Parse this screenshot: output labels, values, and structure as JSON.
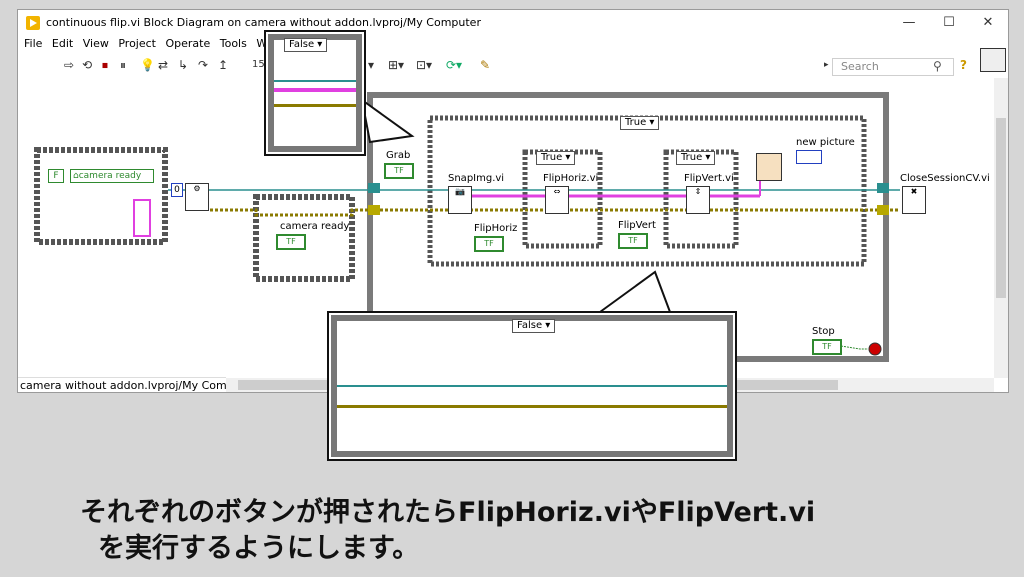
{
  "window": {
    "title": "continuous flip.vi Block Diagram on camera without addon.lvproj/My Computer",
    "minimize": "—",
    "maximize": "☐",
    "close": "✕"
  },
  "menu": [
    "File",
    "Edit",
    "View",
    "Project",
    "Operate",
    "Tools",
    "Win"
  ],
  "toolbar": {
    "font_size": "15",
    "search_placeholder": "Search"
  },
  "statusbar": "camera without addon.lvproj/My Computer",
  "diagram": {
    "camera_ready_const": "camera ready",
    "zero_const": "0",
    "camera_ready_label": "camera ready",
    "tf_label": "TF",
    "grab_label": "Grab",
    "snapimg_label": "SnapImg.vi",
    "fliphoriz_label": "FlipHoriz.vi",
    "flipvert_label": "FlipVert.vi",
    "fliphoriz_ctl": "FlipHoriz",
    "flipvert_ctl": "FlipVert",
    "new_picture": "new picture",
    "close_session": "CloseSessionCV.vi",
    "stop": "Stop",
    "case_true": "True",
    "case_false": "False",
    "f_const": "F"
  },
  "bottom_text": {
    "line1": "それぞれのボタンが押されたらFlipHoriz.viやFlipVert.vi",
    "line2": "を実行するようにします。"
  }
}
